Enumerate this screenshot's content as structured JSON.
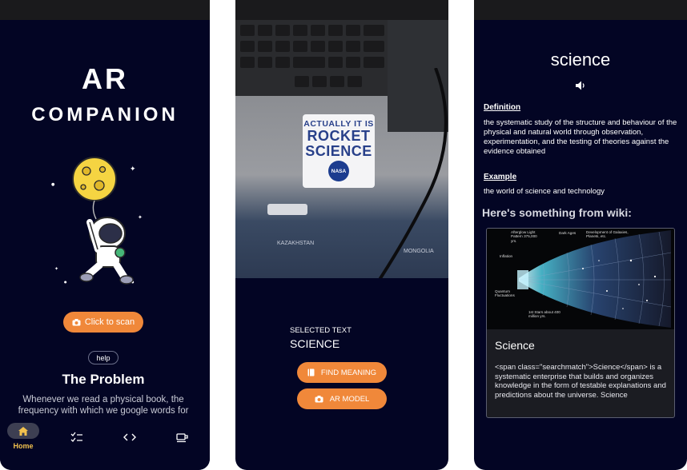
{
  "screen1": {
    "title_line1": "AR",
    "title_line2": "COMPANION",
    "scan_button": "Click to scan",
    "help_button": "help",
    "problem_title": "The Problem",
    "problem_body": "Whenever we read a physical book, the frequency with which we google words for",
    "nav": {
      "home_label": "Home",
      "items": [
        "home-icon",
        "checklist-icon",
        "code-icon",
        "coffee-icon"
      ]
    }
  },
  "screen2": {
    "sticker": {
      "line1": "ACTUALLY IT IS",
      "line2": "ROCKET",
      "line3": "SCIENCE",
      "badge": "NASA"
    },
    "map_labels": [
      "KAZAKHSTAN",
      "MONGOLIA"
    ],
    "selected_label": "SELECTED TEXT",
    "selected_word": "SCIENCE",
    "find_meaning_button": "FIND MEANING",
    "ar_model_button": "AR MODEL"
  },
  "screen3": {
    "word": "science",
    "definition_heading": "Definition",
    "definition_text": "the systematic study of the structure and behaviour of the physical and natural world through observation, experimentation, and the testing of theories against the evidence obtained",
    "example_heading": "Example",
    "example_text": "the world of science and technology",
    "wiki_heading": "Here's something from wiki:",
    "wiki_card": {
      "image_labels": [
        "Afterglow Light Pattern 375,000 yrs.",
        "Dark Ages",
        "Development of Galaxies, Planets, etc.",
        "Inflation",
        "Quantum Fluctuations",
        "1st Stars about 400 million yrs."
      ],
      "title": "Science",
      "text": "<span class=\"searchmatch\">Science</span> is a systematic enterprise that builds and organizes knowledge in the form of testable explanations and predictions about the universe. Science"
    }
  },
  "colors": {
    "background": "#030524",
    "accent": "#f0883a",
    "nav_active": "#f2c14e"
  }
}
